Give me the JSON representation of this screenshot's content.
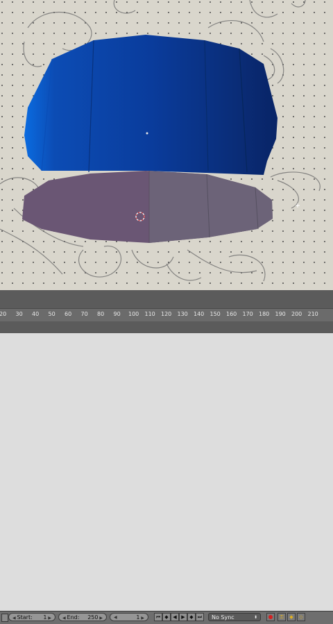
{
  "viewport": {
    "background_color": "#d9d6cc",
    "object_top_color": "#0a3c9c",
    "object_bottom_color": "#6a5674"
  },
  "timeline": {
    "ruler_ticks": [
      "20",
      "30",
      "40",
      "50",
      "60",
      "70",
      "80",
      "90",
      "100",
      "110",
      "120",
      "130",
      "140",
      "150",
      "160",
      "170",
      "180",
      "190",
      "200",
      "210"
    ],
    "start_label": "Start:",
    "start_value": "1",
    "end_label": "End:",
    "end_value": "250",
    "current_frame": "1",
    "sync_mode": "No Sync",
    "playback_icons": [
      "jump-start-icon",
      "prev-keyframe-icon",
      "play-reverse-icon",
      "play-icon",
      "next-keyframe-icon",
      "jump-end-icon"
    ]
  }
}
